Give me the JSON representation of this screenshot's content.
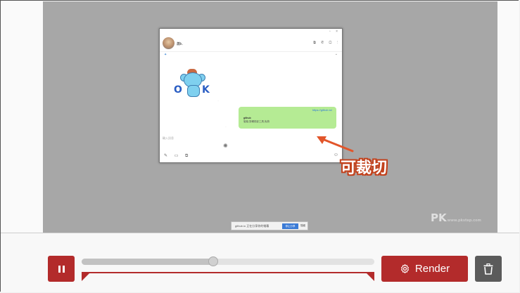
{
  "video": {
    "chat_window": {
      "name": "蕭k.",
      "link": "https://github.io/",
      "bubble_title": "github",
      "bubble_desc": "螢幕,剪輯錄影工具,免費",
      "placeholder": "輸入訊息"
    },
    "bottom_bar": {
      "text": "github.io 正在分享你的螢幕",
      "stop_label": "停止分享",
      "hide_label": "隱藏"
    },
    "sticker_text_left": "O",
    "sticker_text_right": "K"
  },
  "annotation": {
    "text": "可裁切",
    "color": "#e2552a"
  },
  "watermark": {
    "main": "PK",
    "sub": "www.pkstep.com"
  },
  "controls": {
    "render_label": "Render",
    "progress": 0.45,
    "trim_start": 0.0,
    "trim_end": 1.0,
    "accent": "#b32b2b",
    "trash_color": "#5b5b5b"
  }
}
